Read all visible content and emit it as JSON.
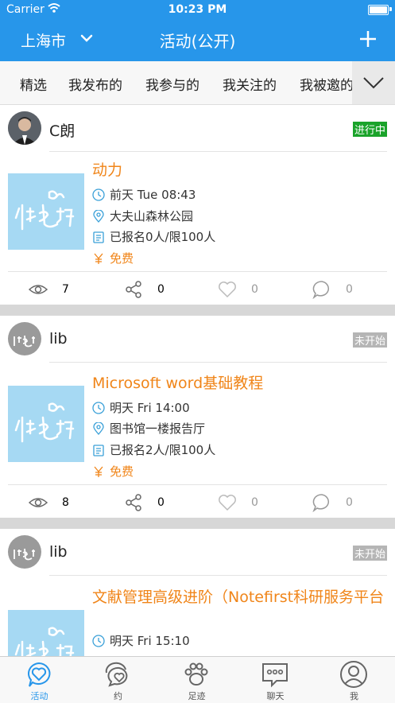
{
  "status": {
    "carrier": "Carrier",
    "time": "10:23 PM"
  },
  "nav": {
    "city": "上海市",
    "title": "活动(公开)"
  },
  "tabs": [
    "精选",
    "我发布的",
    "我参与的",
    "我关注的",
    "我被邀的"
  ],
  "cards": [
    {
      "user": "C朗",
      "status": "进行中",
      "status_color": "#1aa32a",
      "title": "动力",
      "time": "前天 Tue 08:43",
      "place": "大夫山森林公园",
      "signup": "已报名0人/限100人",
      "price": "免费",
      "views": "7",
      "shares": "0",
      "likes": "0",
      "comments": "0"
    },
    {
      "user": "lib",
      "status": "未开始",
      "status_color": "#b5b5b5",
      "title": "Microsoft word基础教程",
      "time": "明天 Fri 14:00",
      "place": "图书馆一楼报告厅",
      "signup": "已报名2人/限100人",
      "price": "免费",
      "views": "8",
      "shares": "0",
      "likes": "0",
      "comments": "0"
    },
    {
      "user": "lib",
      "status": "未开始",
      "status_color": "#b5b5b5",
      "title": "文献管理高级进阶（Notefirst科研服务平台",
      "time": "明天 Fri 15:10"
    }
  ],
  "tabbar": [
    "活动",
    "约",
    "足迹",
    "聊天",
    "我"
  ],
  "colors": {
    "brand": "#2796ea",
    "accent": "#f08519",
    "icon": "#3aa0d8"
  }
}
